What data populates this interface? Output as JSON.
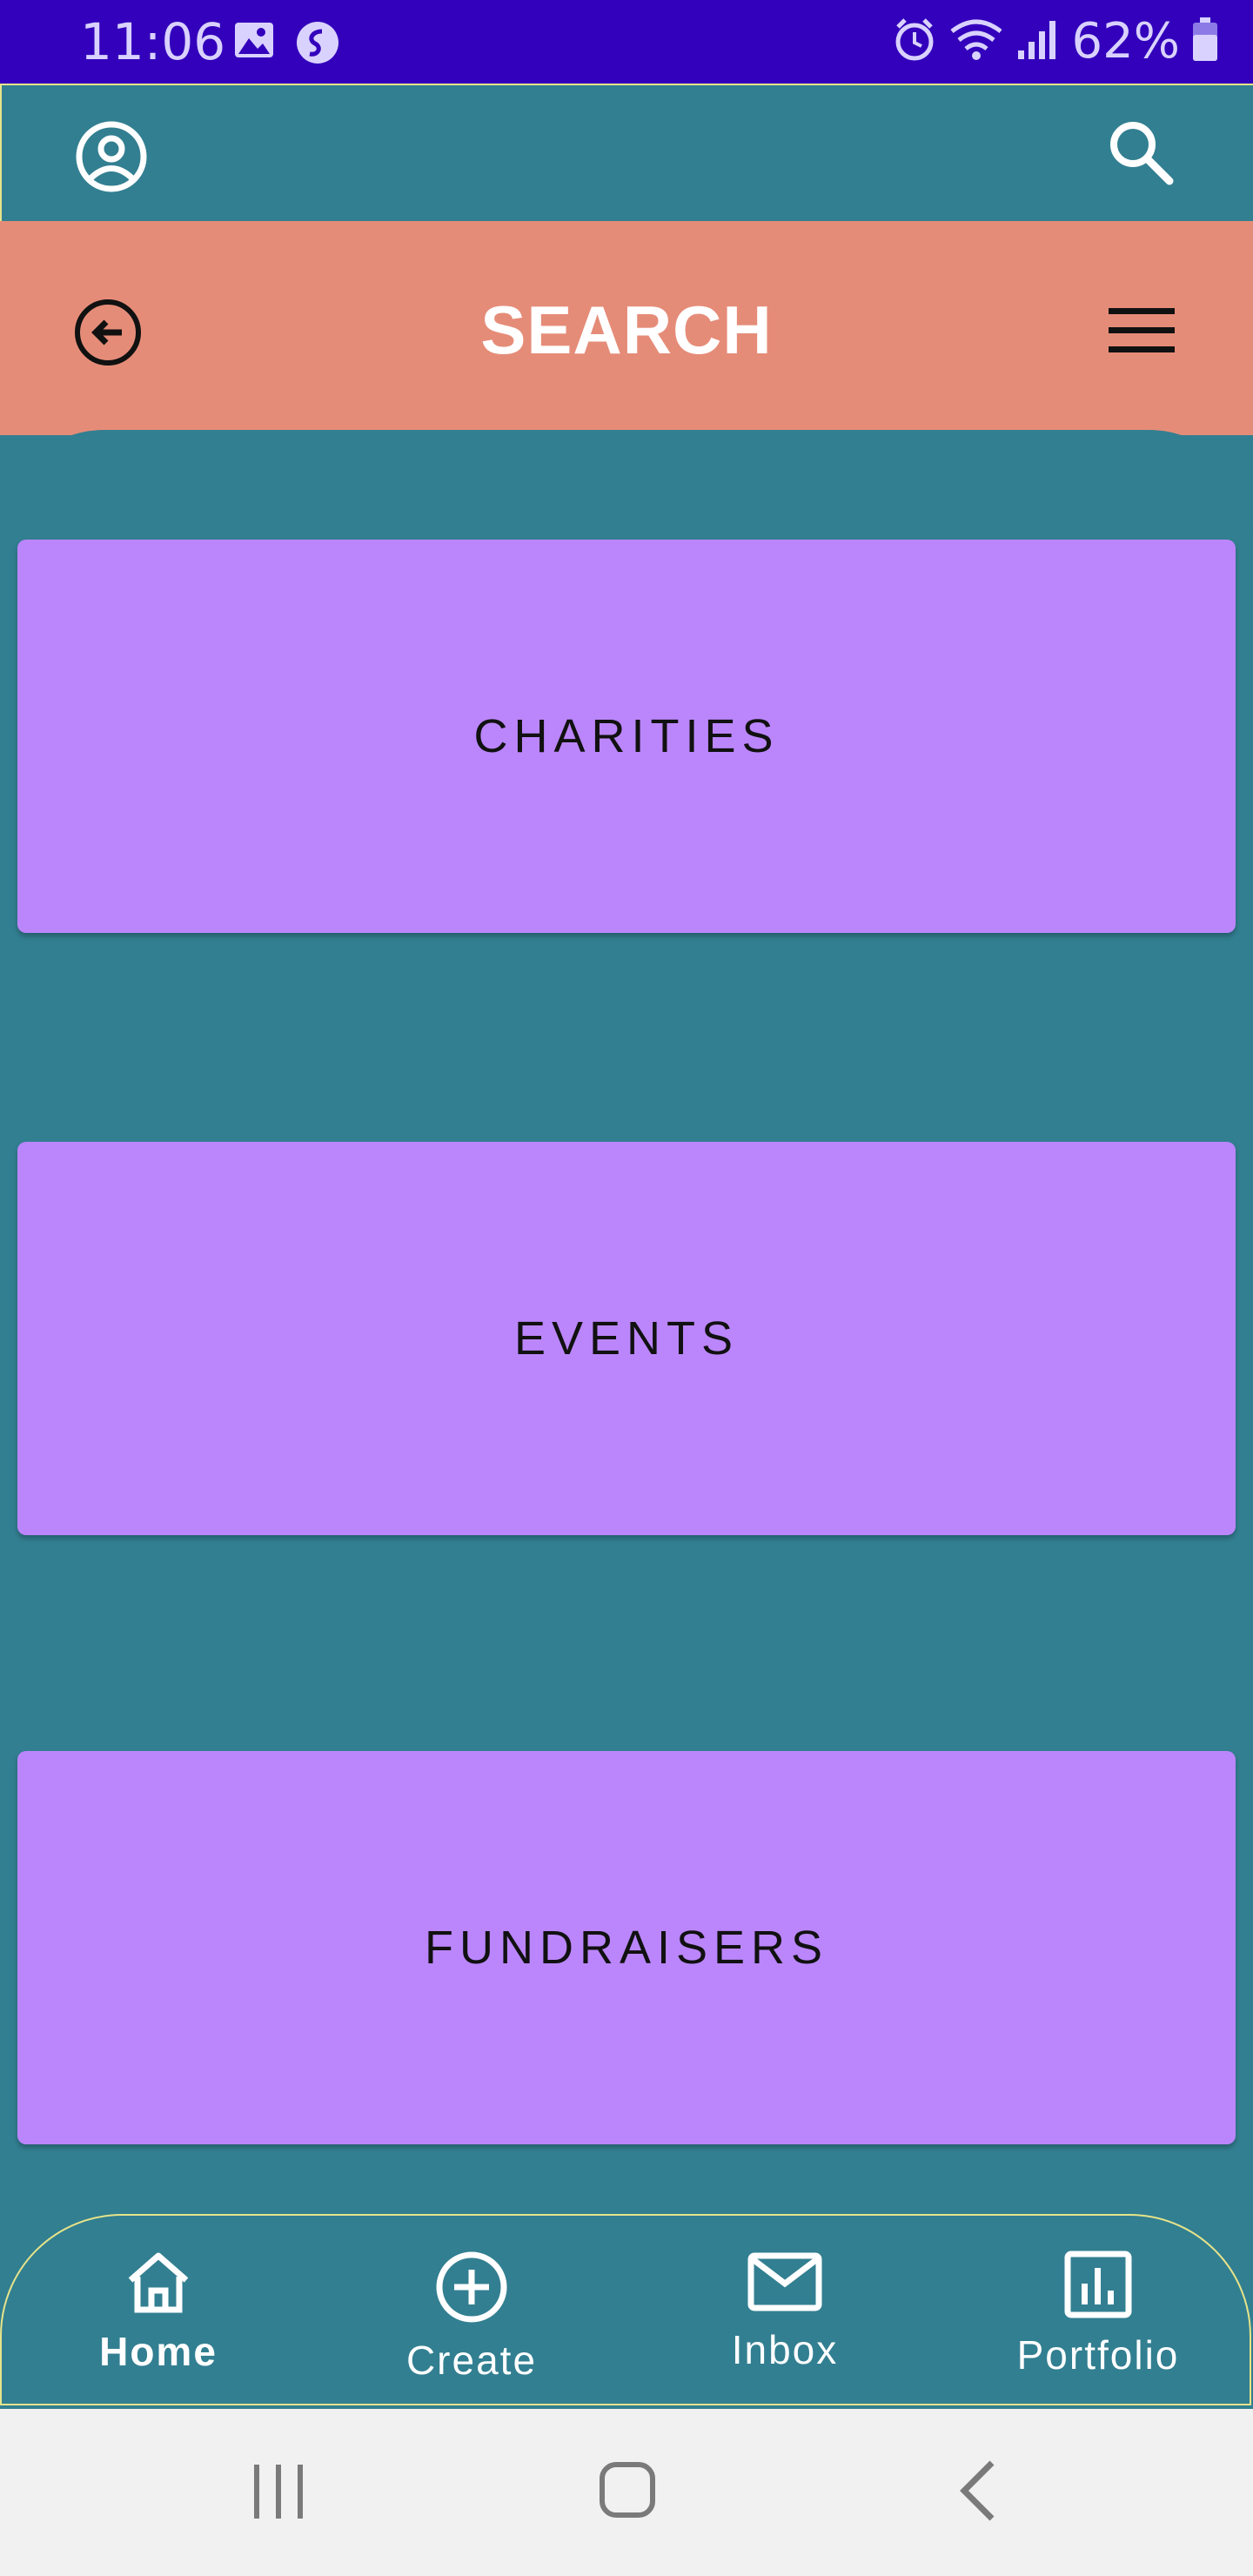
{
  "status_bar": {
    "time": "11:06",
    "battery": "62%",
    "icons": [
      "gallery-icon",
      "shazam-icon",
      "alarm-icon",
      "wifi-icon",
      "signal-icon",
      "battery-icon"
    ]
  },
  "top_bar": {
    "icons": [
      "profile-icon",
      "search-icon"
    ]
  },
  "header": {
    "title": "SEARCH",
    "icons": [
      "back-arrow-icon",
      "menu-icon"
    ]
  },
  "categories": [
    {
      "label": "CHARITIES"
    },
    {
      "label": "EVENTS"
    },
    {
      "label": "FUNDRAISERS"
    }
  ],
  "bottom_nav": {
    "items": [
      {
        "label": "Home",
        "icon": "home-icon",
        "active": true
      },
      {
        "label": "Create",
        "icon": "add-circle-icon",
        "active": false
      },
      {
        "label": "Inbox",
        "icon": "mail-icon",
        "active": false
      },
      {
        "label": "Portfolio",
        "icon": "bar-chart-icon",
        "active": false
      }
    ]
  },
  "colors": {
    "status_bar": "#3300bb",
    "teal": "#327f91",
    "header": "#e58c78",
    "card": "#bb86fc",
    "outline": "#e7e48a",
    "system_nav": "#f1f1f1"
  }
}
